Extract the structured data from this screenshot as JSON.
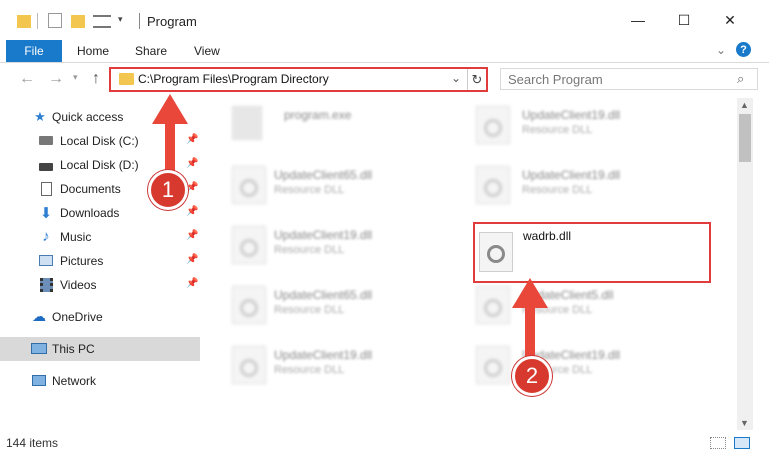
{
  "window": {
    "title": "Program",
    "minimize": "—",
    "maximize": "☐",
    "close": "✕"
  },
  "ribbon": {
    "file": "File",
    "home": "Home",
    "share": "Share",
    "view": "View"
  },
  "nav": {
    "address": "C:\\Program Files\\Program Directory",
    "search_placeholder": "Search Program"
  },
  "sidebar": {
    "items": [
      {
        "label": "Quick access",
        "icon": "star-icon",
        "pinned": false
      },
      {
        "label": "Local Disk (C:)",
        "icon": "drive-icon",
        "pinned": true
      },
      {
        "label": "Local Disk (D:)",
        "icon": "drive-icon",
        "pinned": true
      },
      {
        "label": "Documents",
        "icon": "documents-icon",
        "pinned": true
      },
      {
        "label": "Downloads",
        "icon": "download-icon",
        "pinned": true
      },
      {
        "label": "Music",
        "icon": "music-icon",
        "pinned": true
      },
      {
        "label": "Pictures",
        "icon": "pictures-icon",
        "pinned": true
      },
      {
        "label": "Videos",
        "icon": "videos-icon",
        "pinned": true
      },
      {
        "label": "OneDrive",
        "icon": "cloud-icon",
        "pinned": false
      },
      {
        "label": "This PC",
        "icon": "pc-icon",
        "pinned": false,
        "selected": true
      },
      {
        "label": "Network",
        "icon": "network-icon",
        "pinned": false
      }
    ]
  },
  "files": [
    {
      "name": "program.exe",
      "type": ""
    },
    {
      "name": "UpdateClient19.dll",
      "type": "Resource DLL"
    },
    {
      "name": "UpdateClient65.dll",
      "type": "Resource DLL"
    },
    {
      "name": "UpdateClient19.dll",
      "type": "Resource DLL"
    },
    {
      "name": "UpdateClient19.dll",
      "type": "Resource DLL"
    },
    {
      "name": "wadrb.dll",
      "type": ""
    },
    {
      "name": "UpdateClient65.dll",
      "type": "Resource DLL"
    },
    {
      "name": "UpdateClient5.dll",
      "type": "Resource DLL"
    },
    {
      "name": "UpdateClient19.dll",
      "type": "Resource DLL"
    },
    {
      "name": "UpdateClient19.dll",
      "type": "Resource DLL"
    }
  ],
  "status": {
    "items_count": "144 items"
  },
  "annotations": {
    "step1": "1",
    "step2": "2",
    "color": "#e03c3c"
  }
}
